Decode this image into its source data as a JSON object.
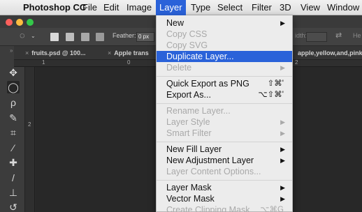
{
  "menubar": {
    "app_name": "Photoshop CC",
    "items": [
      "File",
      "Edit",
      "Image",
      "Layer",
      "Type",
      "Select",
      "Filter",
      "3D",
      "View",
      "Window"
    ]
  },
  "options_bar": {
    "feather_label": "Feather:",
    "feather_value": "0 px",
    "width_label": "idth:",
    "height_label": "He"
  },
  "tabs": [
    {
      "close": "×",
      "label": "fruits.psd @ 100..."
    },
    {
      "close": "×",
      "label": "Apple trans"
    },
    {
      "close": "",
      "label": "apple,yellow,and,pink"
    }
  ],
  "rulers": {
    "n1": "1",
    "n0": "0",
    "n2": "2",
    "v2": "2"
  },
  "layer_menu": {
    "new": "New",
    "copy_css": "Copy CSS",
    "copy_svg": "Copy SVG",
    "duplicate_layer": "Duplicate Layer...",
    "delete": "Delete",
    "quick_export": "Quick Export as PNG",
    "quick_export_shortcut": "⇧⌘'",
    "export_as": "Export As...",
    "export_as_shortcut": "⌥⇧⌘'",
    "rename_layer": "Rename Layer...",
    "layer_style": "Layer Style",
    "smart_filter": "Smart Filter",
    "new_fill_layer": "New Fill Layer",
    "new_adjustment_layer": "New Adjustment Layer",
    "layer_content_options": "Layer Content Options...",
    "layer_mask": "Layer Mask",
    "vector_mask": "Vector Mask",
    "create_clipping_mask": "Create Clipping Mask",
    "create_clipping_mask_shortcut": "⌥⌘G",
    "submenu_arrow": "▶"
  },
  "colors": {
    "menu_highlight": "#2a62d9",
    "traffic_red": "#fc605c",
    "traffic_yellow": "#fdbc40",
    "traffic_green": "#34c84a"
  }
}
